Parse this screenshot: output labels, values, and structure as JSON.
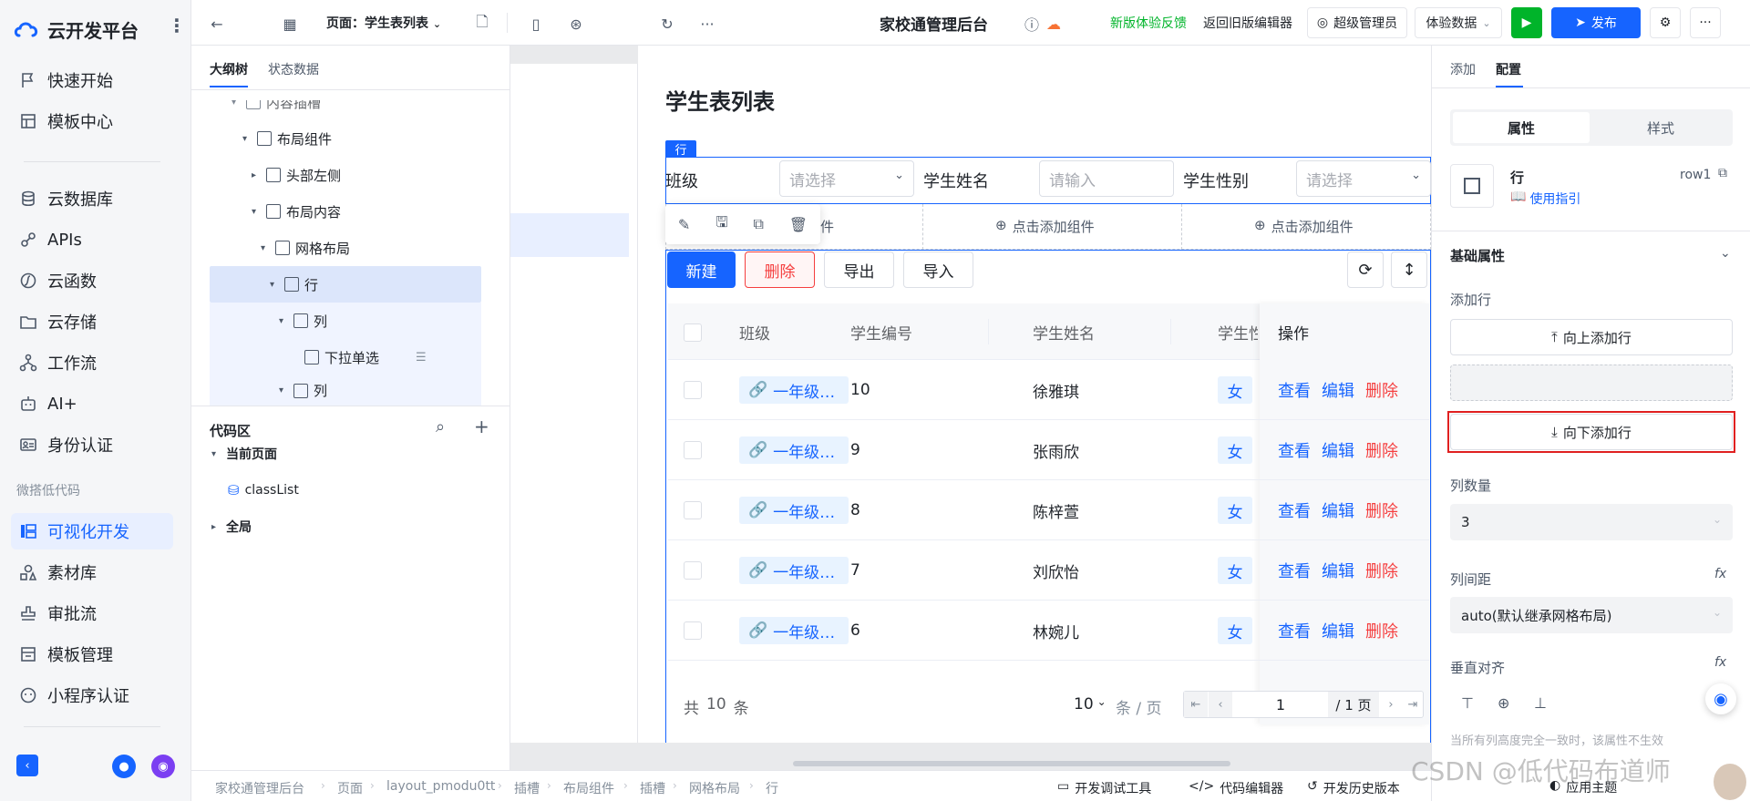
{
  "sidebar": {
    "brand": "云开发平台",
    "items": [
      {
        "label": "快速开始",
        "icon": "flag-icon"
      },
      {
        "label": "模板中心",
        "icon": "template-icon"
      },
      {
        "label": "云数据库",
        "icon": "database-icon"
      },
      {
        "label": "APIs",
        "icon": "api-icon"
      },
      {
        "label": "云函数",
        "icon": "function-icon"
      },
      {
        "label": "云存储",
        "icon": "folder-icon"
      },
      {
        "label": "工作流",
        "icon": "workflow-icon"
      },
      {
        "label": "AI+",
        "icon": "robot-icon"
      },
      {
        "label": "身份认证",
        "icon": "id-card-icon"
      },
      {
        "label": "可视化开发",
        "icon": "visual-dev-icon"
      },
      {
        "label": "素材库",
        "icon": "assets-icon"
      },
      {
        "label": "审批流",
        "icon": "approval-icon"
      },
      {
        "label": "模板管理",
        "icon": "template-manage-icon"
      },
      {
        "label": "小程序认证",
        "icon": "miniprogram-icon"
      }
    ],
    "group_label": "微搭低代码",
    "active_item": "可视化开发",
    "accent": "#1664ff"
  },
  "topbar": {
    "page_label": "页面：学生表列表",
    "app_title": "家校通管理后台",
    "feedback": "新版体验反馈",
    "back_old": "返回旧版编辑器",
    "admin": "超级管理员",
    "data_mode": "体验数据",
    "publish": "发布",
    "feedback_color": "#00b42a"
  },
  "outline": {
    "tabs": [
      "大纲树",
      "状态数据"
    ],
    "nodes": [
      "内容插槽",
      "布局组件",
      "头部左侧",
      "布局内容",
      "网格布局",
      "行",
      "列",
      "下拉单选",
      "列"
    ]
  },
  "code": {
    "title": "代码区",
    "current_page": "当前页面",
    "item": "classList",
    "global": "全局"
  },
  "canvas": {
    "page_title": "学生表列表",
    "row_badge": "行",
    "filters": [
      {
        "label": "班级",
        "placeholder": "请选择"
      },
      {
        "label": "学生姓名",
        "placeholder": "请输入"
      },
      {
        "label": "学生性别",
        "placeholder": "请选择"
      }
    ],
    "add_component": "点击添加组件",
    "add_component_partial": "组件",
    "buttons": {
      "new": "新建",
      "delete": "删除",
      "export": "导出",
      "import": "导入"
    },
    "table": {
      "headers": [
        "班级",
        "学生编号",
        "学生姓名",
        "学生性",
        "操作"
      ],
      "rows": [
        {
          "class": "一年级…",
          "id": "10",
          "name": "徐雅琪",
          "sex": "女"
        },
        {
          "class": "一年级…",
          "id": "9",
          "name": "张雨欣",
          "sex": "女"
        },
        {
          "class": "一年级…",
          "id": "8",
          "name": "陈梓萱",
          "sex": "女"
        },
        {
          "class": "一年级…",
          "id": "7",
          "name": "刘欣怡",
          "sex": "女"
        },
        {
          "class": "一年级…",
          "id": "6",
          "name": "林婉儿",
          "sex": "女"
        }
      ],
      "actions": {
        "view": "查看",
        "edit": "编辑",
        "delete": "删除"
      }
    },
    "pagination": {
      "total_prefix": "共",
      "total": "10",
      "total_suffix": "条",
      "page_size": "10",
      "per_page": "条 / 页",
      "current": "1",
      "pages": "/ 1 页"
    }
  },
  "right_panel": {
    "tabs": [
      "添加",
      "配置"
    ],
    "seg": [
      "属性",
      "样式"
    ],
    "component_name": "行",
    "component_id": "row1",
    "guide": "使用指引",
    "section": "基础属性",
    "add_row_label": "添加行",
    "add_above": "向上添加行",
    "add_below": "向下添加行",
    "col_count_label": "列数量",
    "col_count": "3",
    "col_gap_label": "列间距",
    "col_gap": "auto(默认继承网格布局)",
    "valign_label": "垂直对齐",
    "hint": "当所有列高度完全一致时，该属性不生效"
  },
  "bottombar": {
    "crumbs": [
      "家校通管理后台",
      "页面",
      "layout_pmodu0tt",
      "插槽",
      "布局组件",
      "插槽",
      "网格布局",
      "行"
    ],
    "tools": [
      "开发调试工具",
      "代码编辑器",
      "开发历史版本"
    ],
    "theme": "应用主题"
  },
  "watermark": "CSDN @低代码布道师"
}
